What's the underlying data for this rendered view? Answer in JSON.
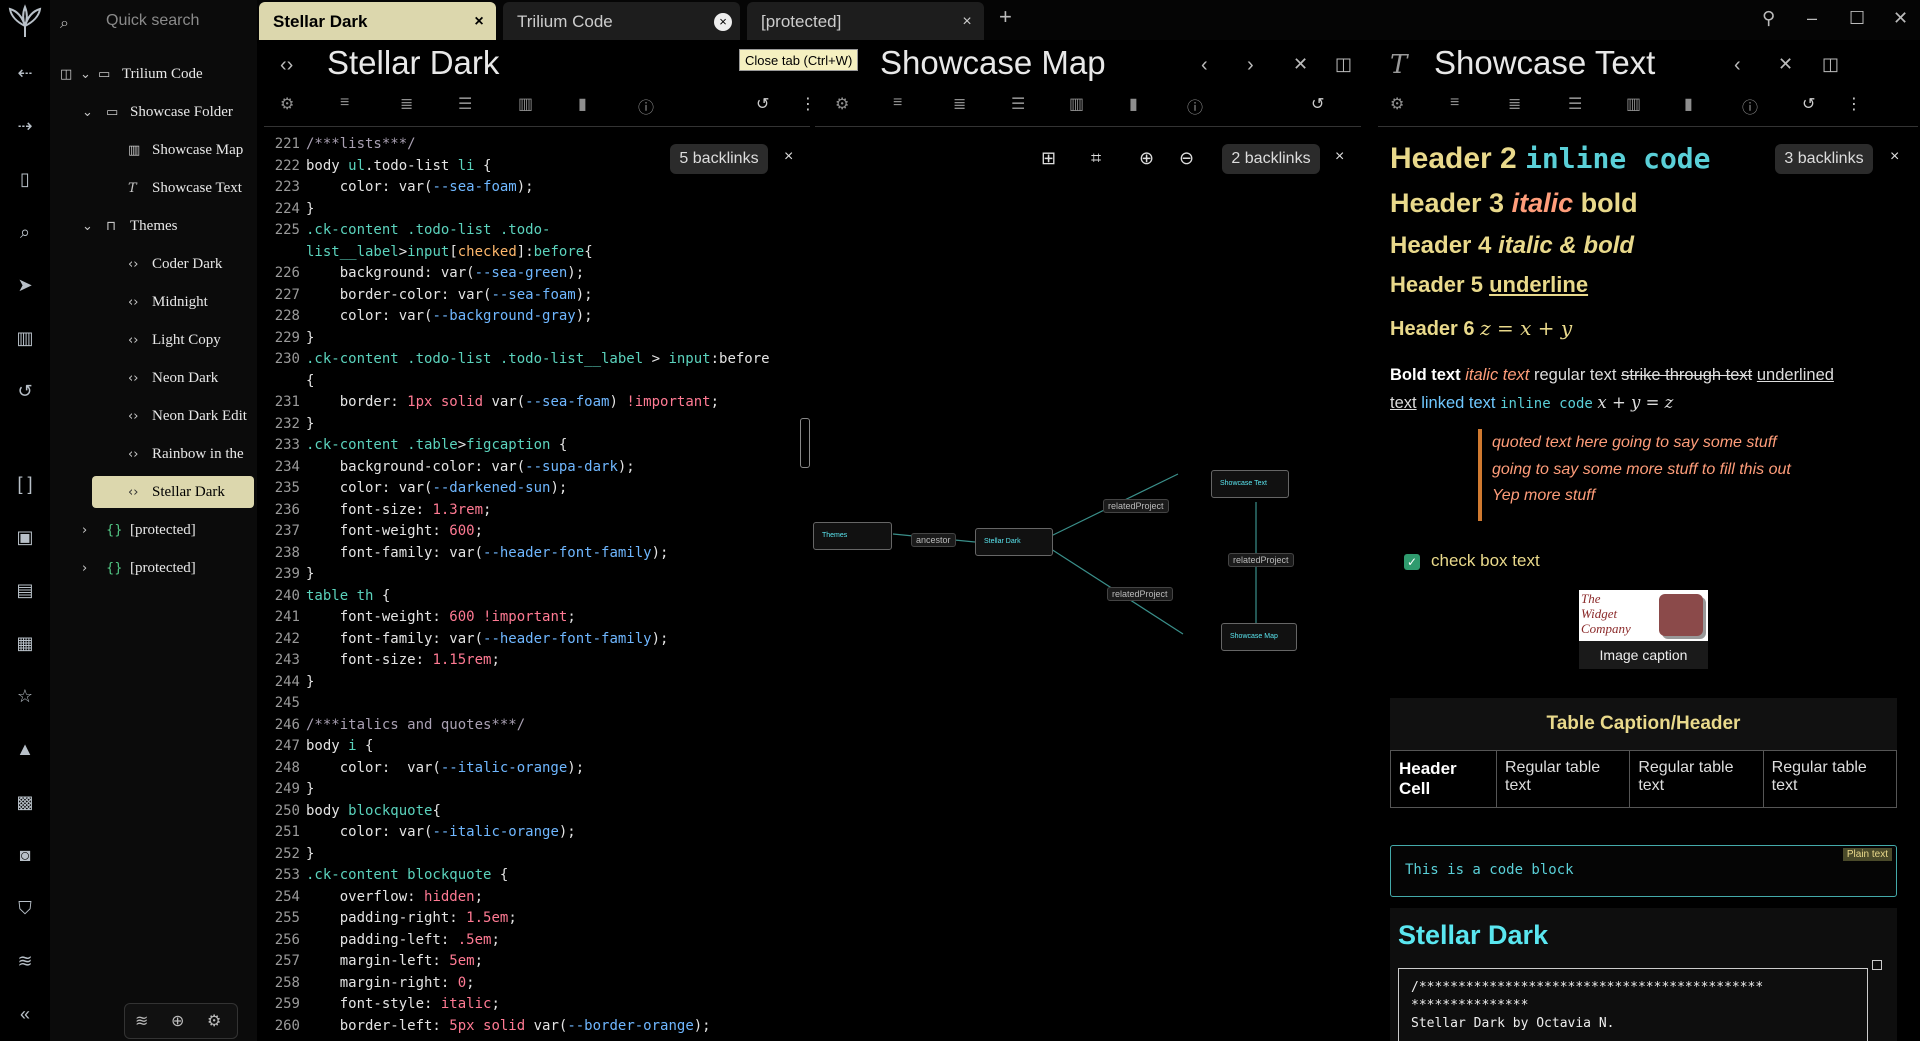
{
  "app": {
    "search_placeholder": "Quick search"
  },
  "tree": {
    "root": "Trilium Code",
    "showcase_folder": "Showcase Folder",
    "showcase_map": "Showcase Map",
    "showcase_text": "Showcase Text",
    "themes": "Themes",
    "theme_items": [
      "Coder Dark",
      "Midnight",
      "Light Copy",
      "Neon Dark",
      "Neon Dark Edit",
      "Rainbow in the",
      "Stellar Dark"
    ],
    "protected_1": "[protected]",
    "protected_2": "[protected]"
  },
  "tabs": [
    {
      "label": "Stellar Dark",
      "active": true
    },
    {
      "label": "Trilium Code",
      "active": false
    },
    {
      "label": "[protected]",
      "active": false
    }
  ],
  "tooltip": "Close tab (Ctrl+W)",
  "pane_code": {
    "title": "Stellar Dark",
    "backlinks": "5 backlinks",
    "lines": [
      {
        "n": "221",
        "t": [
          {
            "c": "c",
            "s": "/***lists***/"
          }
        ]
      },
      {
        "n": "222",
        "t": [
          {
            "c": "k",
            "s": "body "
          },
          {
            "c": "g",
            "s": "ul"
          },
          {
            "c": "k",
            "s": ".todo-list "
          },
          {
            "c": "g",
            "s": "li"
          },
          {
            "c": "k",
            "s": " {"
          }
        ]
      },
      {
        "n": "223",
        "t": [
          {
            "c": "k",
            "s": "    color: var("
          },
          {
            "c": "v",
            "s": "--sea-foam"
          },
          {
            "c": "k",
            "s": ");"
          }
        ]
      },
      {
        "n": "224",
        "t": [
          {
            "c": "k",
            "s": "}"
          }
        ]
      },
      {
        "n": "225",
        "t": [
          {
            "c": "g",
            "s": ".ck-content .todo-list .todo-"
          }
        ]
      },
      {
        "n": "",
        "t": [
          {
            "c": "g",
            "s": "list__label"
          },
          {
            "c": "k",
            "s": ">"
          },
          {
            "c": "g",
            "s": "input"
          },
          {
            "c": "k",
            "s": "["
          },
          {
            "c": "s",
            "s": "checked"
          },
          {
            "c": "k",
            "s": "]:"
          },
          {
            "c": "g",
            "s": "before"
          },
          {
            "c": "k",
            "s": "{"
          }
        ]
      },
      {
        "n": "226",
        "t": [
          {
            "c": "k",
            "s": "    background: var("
          },
          {
            "c": "v",
            "s": "--sea-green"
          },
          {
            "c": "k",
            "s": ");"
          }
        ]
      },
      {
        "n": "227",
        "t": [
          {
            "c": "k",
            "s": "    border-color: var("
          },
          {
            "c": "v",
            "s": "--sea-foam"
          },
          {
            "c": "k",
            "s": ");"
          }
        ]
      },
      {
        "n": "228",
        "t": [
          {
            "c": "k",
            "s": "    color: var("
          },
          {
            "c": "v",
            "s": "--background-gray"
          },
          {
            "c": "k",
            "s": ");"
          }
        ]
      },
      {
        "n": "229",
        "t": [
          {
            "c": "k",
            "s": "}"
          }
        ]
      },
      {
        "n": "230",
        "t": [
          {
            "c": "g",
            "s": ".ck-content .todo-list .todo-list__label "
          },
          {
            "c": "k",
            "s": "> "
          },
          {
            "c": "g",
            "s": "input"
          },
          {
            "c": "k",
            "s": ":before"
          }
        ]
      },
      {
        "n": "",
        "t": [
          {
            "c": "k",
            "s": "{"
          }
        ]
      },
      {
        "n": "231",
        "t": [
          {
            "c": "k",
            "s": "    border: "
          },
          {
            "c": "n",
            "s": "1px solid "
          },
          {
            "c": "k",
            "s": "var("
          },
          {
            "c": "v",
            "s": "--sea-foam"
          },
          {
            "c": "k",
            "s": ") "
          },
          {
            "c": "n",
            "s": "!important"
          },
          {
            "c": "k",
            "s": ";"
          }
        ]
      },
      {
        "n": "232",
        "t": [
          {
            "c": "k",
            "s": "}"
          }
        ]
      },
      {
        "n": "233",
        "t": [
          {
            "c": "g",
            "s": ".ck-content .table"
          },
          {
            "c": "k",
            "s": ">"
          },
          {
            "c": "g",
            "s": "figcaption"
          },
          {
            "c": "k",
            "s": " {"
          }
        ]
      },
      {
        "n": "234",
        "t": [
          {
            "c": "k",
            "s": "    background-color: var("
          },
          {
            "c": "v",
            "s": "--supa-dark"
          },
          {
            "c": "k",
            "s": ");"
          }
        ]
      },
      {
        "n": "235",
        "t": [
          {
            "c": "k",
            "s": "    color: var("
          },
          {
            "c": "v",
            "s": "--darkened-sun"
          },
          {
            "c": "k",
            "s": ");"
          }
        ]
      },
      {
        "n": "236",
        "t": [
          {
            "c": "k",
            "s": "    font-size: "
          },
          {
            "c": "n",
            "s": "1.3rem"
          },
          {
            "c": "k",
            "s": ";"
          }
        ]
      },
      {
        "n": "237",
        "t": [
          {
            "c": "k",
            "s": "    font-weight: "
          },
          {
            "c": "n",
            "s": "600"
          },
          {
            "c": "k",
            "s": ";"
          }
        ]
      },
      {
        "n": "238",
        "t": [
          {
            "c": "k",
            "s": "    font-family: var("
          },
          {
            "c": "v",
            "s": "--header-font-family"
          },
          {
            "c": "k",
            "s": ");"
          }
        ]
      },
      {
        "n": "239",
        "t": [
          {
            "c": "k",
            "s": "}"
          }
        ]
      },
      {
        "n": "240",
        "t": [
          {
            "c": "g",
            "s": "table th "
          },
          {
            "c": "k",
            "s": "{"
          }
        ]
      },
      {
        "n": "241",
        "t": [
          {
            "c": "k",
            "s": "    font-weight: "
          },
          {
            "c": "n",
            "s": "600 !important"
          },
          {
            "c": "k",
            "s": ";"
          }
        ]
      },
      {
        "n": "242",
        "t": [
          {
            "c": "k",
            "s": "    font-family: var("
          },
          {
            "c": "v",
            "s": "--header-font-family"
          },
          {
            "c": "k",
            "s": ");"
          }
        ]
      },
      {
        "n": "243",
        "t": [
          {
            "c": "k",
            "s": "    font-size: "
          },
          {
            "c": "n",
            "s": "1.15rem"
          },
          {
            "c": "k",
            "s": ";"
          }
        ]
      },
      {
        "n": "244",
        "t": [
          {
            "c": "k",
            "s": "}"
          }
        ]
      },
      {
        "n": "245",
        "t": []
      },
      {
        "n": "246",
        "t": [
          {
            "c": "c",
            "s": "/***italics and quotes***/"
          }
        ]
      },
      {
        "n": "247",
        "t": [
          {
            "c": "k",
            "s": "body "
          },
          {
            "c": "g",
            "s": "i"
          },
          {
            "c": "k",
            "s": " {"
          }
        ]
      },
      {
        "n": "248",
        "t": [
          {
            "c": "k",
            "s": "    color:  var("
          },
          {
            "c": "v",
            "s": "--italic-orange"
          },
          {
            "c": "k",
            "s": ");"
          }
        ]
      },
      {
        "n": "249",
        "t": [
          {
            "c": "k",
            "s": "}"
          }
        ]
      },
      {
        "n": "250",
        "t": [
          {
            "c": "k",
            "s": "body "
          },
          {
            "c": "g",
            "s": "blockquote"
          },
          {
            "c": "k",
            "s": "{"
          }
        ]
      },
      {
        "n": "251",
        "t": [
          {
            "c": "k",
            "s": "    color: var("
          },
          {
            "c": "v",
            "s": "--italic-orange"
          },
          {
            "c": "k",
            "s": ");"
          }
        ]
      },
      {
        "n": "252",
        "t": [
          {
            "c": "k",
            "s": "}"
          }
        ]
      },
      {
        "n": "253",
        "t": [
          {
            "c": "g",
            "s": ".ck-content blockquote"
          },
          {
            "c": "k",
            "s": " {"
          }
        ]
      },
      {
        "n": "254",
        "t": [
          {
            "c": "k",
            "s": "    overflow: "
          },
          {
            "c": "n",
            "s": "hidden"
          },
          {
            "c": "k",
            "s": ";"
          }
        ]
      },
      {
        "n": "255",
        "t": [
          {
            "c": "k",
            "s": "    padding-right: "
          },
          {
            "c": "n",
            "s": "1.5em"
          },
          {
            "c": "k",
            "s": ";"
          }
        ]
      },
      {
        "n": "256",
        "t": [
          {
            "c": "k",
            "s": "    padding-left: "
          },
          {
            "c": "n",
            "s": ".5em"
          },
          {
            "c": "k",
            "s": ";"
          }
        ]
      },
      {
        "n": "257",
        "t": [
          {
            "c": "k",
            "s": "    margin-left: "
          },
          {
            "c": "n",
            "s": "5em"
          },
          {
            "c": "k",
            "s": ";"
          }
        ]
      },
      {
        "n": "258",
        "t": [
          {
            "c": "k",
            "s": "    margin-right: "
          },
          {
            "c": "n",
            "s": "0"
          },
          {
            "c": "k",
            "s": ";"
          }
        ]
      },
      {
        "n": "259",
        "t": [
          {
            "c": "k",
            "s": "    font-style: "
          },
          {
            "c": "n",
            "s": "italic"
          },
          {
            "c": "k",
            "s": ";"
          }
        ]
      },
      {
        "n": "260",
        "t": [
          {
            "c": "k",
            "s": "    border-left: "
          },
          {
            "c": "n",
            "s": "5px solid "
          },
          {
            "c": "k",
            "s": "var("
          },
          {
            "c": "v",
            "s": "--border-orange"
          },
          {
            "c": "k",
            "s": ");"
          }
        ]
      }
    ]
  },
  "pane_map": {
    "title": "Showcase Map",
    "backlinks": "2 backlinks",
    "nodes": [
      "Themes",
      "Stellar Dark",
      "Showcase Text",
      "Showcase Map"
    ],
    "edge_labels": [
      "ancestor",
      "relatedProject",
      "relatedProject",
      "relatedProject"
    ]
  },
  "pane_text": {
    "title": "Showcase Text",
    "backlinks": "3 backlinks",
    "h2_text": "Header 2 ",
    "h2_code": "inline code",
    "h3_a": "Header 3 ",
    "h3_i": "italic",
    "h3_b": " bold",
    "h4_a": "Header 4 ",
    "h4_bi": "italic & bold",
    "h5_a": "Header 5 ",
    "h5_u": "underline",
    "h6_a": "Header 6 ",
    "h6_math": "z = x + y",
    "p_bold": "Bold text",
    "p_italic": "italic text",
    "p_regular": "regular text",
    "p_strike": "strike through text",
    "p_underline1": "underlined",
    "p_underline2": "text",
    "p_link": "linked text",
    "p_code": "inline code",
    "p_math": "x + y = z",
    "quote_lines": [
      "quoted text here going to say some stuff",
      "going to say some more stuff to fill this out",
      "Yep more stuff"
    ],
    "check_text": "check box text",
    "logo_text": [
      "The",
      "Widget",
      "Company"
    ],
    "image_caption": "Image caption",
    "table_caption": "Table Caption/Header",
    "table_header": "Header Cell",
    "table_cells": [
      "Regular table text",
      "Regular table text",
      "Regular table text"
    ],
    "code_block_label": "Plain text",
    "code_block": "This is a code block",
    "included_title": "Stellar Dark",
    "included_lines": [
      "/********************************************",
      "***************",
      "Stellar Dark by Octavia N."
    ]
  }
}
